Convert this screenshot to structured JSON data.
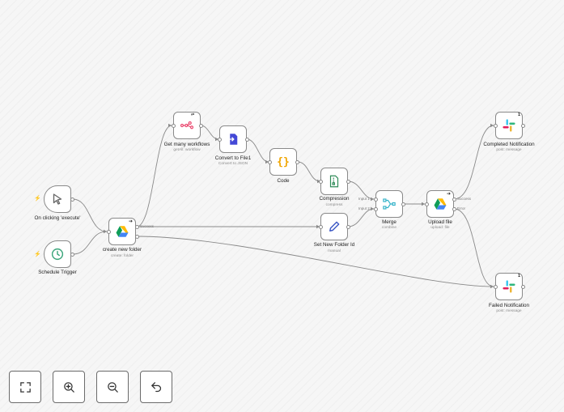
{
  "nodes": {
    "trigger_manual": {
      "label": "On clicking 'execute'"
    },
    "trigger_schedule": {
      "label": "Schedule Trigger"
    },
    "create_folder": {
      "label": "create new folder",
      "subtitle": "create: folder",
      "output_label": "Success"
    },
    "get_workflows": {
      "label": "Get many workflows",
      "subtitle": "getAll: workflow"
    },
    "convert_file": {
      "label": "Convert to File1",
      "subtitle": "Convert to JSON"
    },
    "code": {
      "label": "Code"
    },
    "compression": {
      "label": "Compression",
      "subtitle": "compress"
    },
    "set_folder_id": {
      "label": "Set New Folder Id",
      "subtitle": "manual"
    },
    "merge": {
      "label": "Merge",
      "subtitle": "combine",
      "input1_label": "Input 1",
      "input2_label": "Input 2"
    },
    "upload_file": {
      "label": "Upload file",
      "subtitle": "upload: file",
      "success_label": "Success",
      "error_label": "Error"
    },
    "completed_notification": {
      "label": "Completed Notification",
      "subtitle": "post: message",
      "badge": "1"
    },
    "failed_notification": {
      "label": "Failed Notification",
      "subtitle": "post: message",
      "badge": "1"
    }
  },
  "icons": {
    "manual_trigger": "cursor-arrow-icon",
    "schedule_trigger": "clock-icon",
    "google_drive": "google-drive-icon",
    "n8n": "n8n-workflow-icon",
    "convert_to_file": "file-convert-icon",
    "code": "curly-braces-icon",
    "compression": "zip-file-icon",
    "edit": "pencil-icon",
    "merge": "merge-icon",
    "slack": "slack-icon",
    "trigger_marker": "lightning-bolt-icon"
  },
  "colors": {
    "edge": "#8a8a8a",
    "trigger_bolt": "#ff5d5d",
    "code_orange": "#f0a500",
    "merge_teal": "#36b3c9",
    "n8n_pink": "#ea4b71",
    "edit_blue": "#3e59c5",
    "convert_indigo": "#4348d6",
    "compression_green": "#2e8b57"
  },
  "toolbar": {
    "fit_view": "fit-view-icon",
    "zoom_in": "zoom-in-icon",
    "zoom_out": "zoom-out-icon",
    "undo": "undo-icon"
  }
}
